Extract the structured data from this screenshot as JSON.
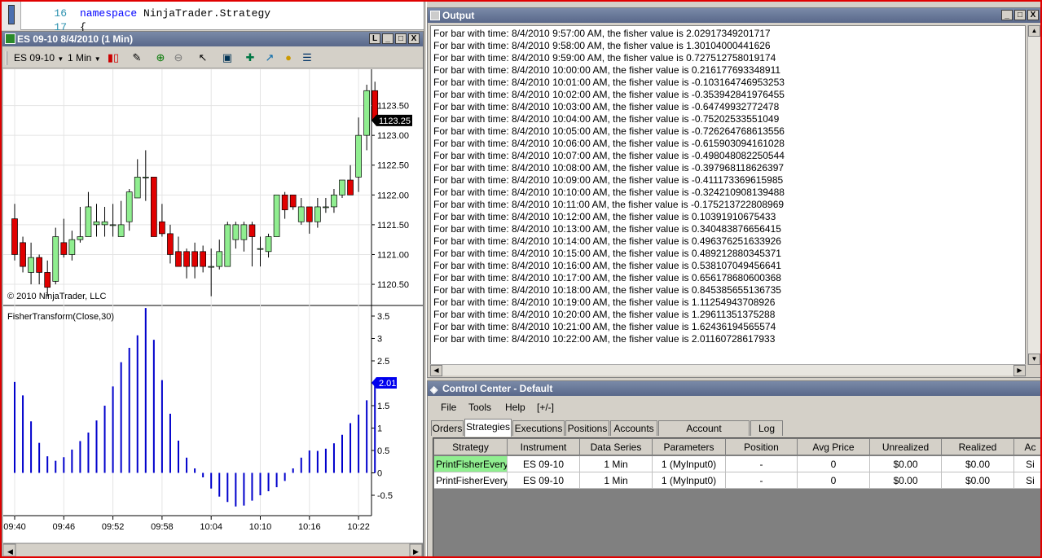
{
  "code": {
    "lines": [
      {
        "num": "16",
        "kw": "namespace",
        "text": " NinjaTrader.Strategy"
      },
      {
        "num": "17",
        "kw": "",
        "text": "{"
      }
    ]
  },
  "chart": {
    "title": "ES 09-10  8/4/2010 (1 Min)",
    "window_buttons": [
      "L",
      "_",
      "□",
      "X"
    ],
    "toolbar": {
      "instrument": "ES 09-10",
      "interval": "1 Min"
    },
    "copyright": "© 2010 NinjaTrader, LLC",
    "indicator_label": "FisherTransform(Close,30)",
    "price_label": "1123.25",
    "fisher_label": "2.01",
    "up_color": "#90ee90",
    "down_color": "#e00000",
    "fisher_color": "#0000cc"
  },
  "chart_data": [
    {
      "type": "candlestick",
      "name": "ES 09-10",
      "xlabels": [
        "09:40",
        "09:46",
        "09:52",
        "09:58",
        "10:04",
        "10:10",
        "10:16",
        "10:22"
      ],
      "yticks": [
        "1123.50",
        "1123.00",
        "1122.50",
        "1122.00",
        "1121.50",
        "1121.00",
        "1120.50"
      ],
      "ylim": [
        1120.2,
        1124.0
      ],
      "candles": [
        {
          "o": 1121.6,
          "h": 1121.85,
          "l": 1120.9,
          "c": 1121.0
        },
        {
          "o": 1121.2,
          "h": 1121.3,
          "l": 1120.7,
          "c": 1120.8
        },
        {
          "o": 1120.7,
          "h": 1121.2,
          "l": 1120.5,
          "c": 1120.95
        },
        {
          "o": 1120.95,
          "h": 1121.0,
          "l": 1120.5,
          "c": 1120.7
        },
        {
          "o": 1120.7,
          "h": 1120.9,
          "l": 1120.3,
          "c": 1120.45
        },
        {
          "o": 1120.55,
          "h": 1121.45,
          "l": 1120.5,
          "c": 1121.3
        },
        {
          "o": 1121.2,
          "h": 1121.6,
          "l": 1120.95,
          "c": 1121.0
        },
        {
          "o": 1121.0,
          "h": 1121.4,
          "l": 1120.9,
          "c": 1121.25
        },
        {
          "o": 1121.25,
          "h": 1121.8,
          "l": 1121.2,
          "c": 1121.3
        },
        {
          "o": 1121.3,
          "h": 1122.05,
          "l": 1121.3,
          "c": 1121.8
        },
        {
          "o": 1121.5,
          "h": 1121.85,
          "l": 1121.3,
          "c": 1121.55
        },
        {
          "o": 1121.5,
          "h": 1121.8,
          "l": 1121.3,
          "c": 1121.55
        },
        {
          "o": 1121.5,
          "h": 1121.85,
          "l": 1121.3,
          "c": 1121.5
        },
        {
          "o": 1121.3,
          "h": 1121.9,
          "l": 1121.3,
          "c": 1121.5
        },
        {
          "o": 1121.55,
          "h": 1122.1,
          "l": 1121.4,
          "c": 1122.05
        },
        {
          "o": 1121.95,
          "h": 1122.6,
          "l": 1121.95,
          "c": 1122.3
        },
        {
          "o": 1122.3,
          "h": 1122.75,
          "l": 1121.9,
          "c": 1122.3
        },
        {
          "o": 1122.3,
          "h": 1122.3,
          "l": 1121.3,
          "c": 1121.3
        },
        {
          "o": 1121.55,
          "h": 1121.85,
          "l": 1121.3,
          "c": 1121.35
        },
        {
          "o": 1121.35,
          "h": 1121.5,
          "l": 1120.85,
          "c": 1121.0
        },
        {
          "o": 1121.05,
          "h": 1121.3,
          "l": 1120.85,
          "c": 1120.8
        },
        {
          "o": 1121.05,
          "h": 1121.1,
          "l": 1120.6,
          "c": 1120.8
        },
        {
          "o": 1121.05,
          "h": 1121.2,
          "l": 1120.6,
          "c": 1120.8
        },
        {
          "o": 1121.05,
          "h": 1121.15,
          "l": 1120.7,
          "c": 1120.8
        },
        {
          "o": 1120.8,
          "h": 1121.1,
          "l": 1120.3,
          "c": 1120.8
        },
        {
          "o": 1120.8,
          "h": 1121.25,
          "l": 1120.75,
          "c": 1121.05
        },
        {
          "o": 1120.8,
          "h": 1121.55,
          "l": 1120.8,
          "c": 1121.5
        },
        {
          "o": 1121.25,
          "h": 1121.55,
          "l": 1121.1,
          "c": 1121.5
        },
        {
          "o": 1121.25,
          "h": 1121.55,
          "l": 1121.05,
          "c": 1121.5
        },
        {
          "o": 1121.5,
          "h": 1121.55,
          "l": 1120.8,
          "c": 1121.3
        },
        {
          "o": 1121.1,
          "h": 1121.3,
          "l": 1120.8,
          "c": 1121.1
        },
        {
          "o": 1121.05,
          "h": 1121.35,
          "l": 1120.95,
          "c": 1121.3
        },
        {
          "o": 1121.3,
          "h": 1122.0,
          "l": 1121.3,
          "c": 1122.0
        },
        {
          "o": 1122.0,
          "h": 1122.05,
          "l": 1121.6,
          "c": 1121.75
        },
        {
          "o": 1122.0,
          "h": 1122.0,
          "l": 1121.75,
          "c": 1121.8
        },
        {
          "o": 1121.55,
          "h": 1121.95,
          "l": 1121.5,
          "c": 1121.8
        },
        {
          "o": 1121.8,
          "h": 1121.8,
          "l": 1121.35,
          "c": 1121.55
        },
        {
          "o": 1121.55,
          "h": 1121.95,
          "l": 1121.45,
          "c": 1121.8
        },
        {
          "o": 1121.8,
          "h": 1121.95,
          "l": 1121.7,
          "c": 1121.8
        },
        {
          "o": 1121.8,
          "h": 1122.1,
          "l": 1121.7,
          "c": 1122.0
        },
        {
          "o": 1122.0,
          "h": 1122.25,
          "l": 1121.95,
          "c": 1122.25
        },
        {
          "o": 1122.25,
          "h": 1122.5,
          "l": 1122.05,
          "c": 1122.0
        },
        {
          "o": 1122.3,
          "h": 1123.3,
          "l": 1122.05,
          "c": 1123.0
        },
        {
          "o": 1123.0,
          "h": 1123.85,
          "l": 1122.75,
          "c": 1123.75
        },
        {
          "o": 1123.75,
          "h": 1123.9,
          "l": 1123.2,
          "c": 1123.25
        }
      ]
    },
    {
      "type": "bar",
      "name": "FisherTransform(Close,30)",
      "yticks": [
        "3.5",
        "3",
        "2.5",
        "2",
        "1.5",
        "1",
        "0.5",
        "0",
        "-0.5"
      ],
      "ylim": [
        -0.9,
        3.7
      ],
      "values": [
        2.03,
        1.73,
        1.15,
        0.67,
        0.37,
        0.27,
        0.35,
        0.52,
        0.71,
        0.9,
        1.17,
        1.5,
        1.93,
        2.47,
        2.79,
        3.07,
        3.68,
        2.97,
        2.07,
        1.32,
        0.72,
        0.34,
        0.1,
        -0.1,
        -0.35,
        -0.53,
        -0.65,
        -0.75,
        -0.73,
        -0.62,
        -0.5,
        -0.41,
        -0.32,
        -0.18,
        0.1,
        0.34,
        0.5,
        0.49,
        0.54,
        0.66,
        0.85,
        1.11,
        1.3,
        1.62,
        2.01
      ]
    }
  ],
  "output": {
    "title": "Output",
    "lines": [
      "For bar with time: 8/4/2010 9:57:00 AM, the fisher value is 2.02917349201717",
      "For bar with time: 8/4/2010 9:58:00 AM, the fisher value is 1.30104000441626",
      "For bar with time: 8/4/2010 9:59:00 AM, the fisher value is 0.727512758019174",
      "For bar with time: 8/4/2010 10:00:00 AM, the fisher value is 0.216177693348911",
      "For bar with time: 8/4/2010 10:01:00 AM, the fisher value is -0.103164746953253",
      "For bar with time: 8/4/2010 10:02:00 AM, the fisher value is -0.353942841976455",
      "For bar with time: 8/4/2010 10:03:00 AM, the fisher value is -0.64749932772478",
      "For bar with time: 8/4/2010 10:04:00 AM, the fisher value is -0.75202533551049",
      "For bar with time: 8/4/2010 10:05:00 AM, the fisher value is -0.726264768613556",
      "For bar with time: 8/4/2010 10:06:00 AM, the fisher value is -0.615903094161028",
      "For bar with time: 8/4/2010 10:07:00 AM, the fisher value is -0.498048082250544",
      "For bar with time: 8/4/2010 10:08:00 AM, the fisher value is -0.397968118626397",
      "For bar with time: 8/4/2010 10:09:00 AM, the fisher value is -0.411173369615985",
      "For bar with time: 8/4/2010 10:10:00 AM, the fisher value is -0.324210908139488",
      "For bar with time: 8/4/2010 10:11:00 AM, the fisher value is -0.175213722808969",
      "For bar with time: 8/4/2010 10:12:00 AM, the fisher value is 0.10391910675433",
      "For bar with time: 8/4/2010 10:13:00 AM, the fisher value is 0.340483876656415",
      "For bar with time: 8/4/2010 10:14:00 AM, the fisher value is 0.496376251633926",
      "For bar with time: 8/4/2010 10:15:00 AM, the fisher value is 0.489212880345371",
      "For bar with time: 8/4/2010 10:16:00 AM, the fisher value is 0.538107049456641",
      "For bar with time: 8/4/2010 10:17:00 AM, the fisher value is 0.656178680600368",
      "For bar with time: 8/4/2010 10:18:00 AM, the fisher value is 0.845385655136735",
      "For bar with time: 8/4/2010 10:19:00 AM, the fisher value is 1.11254943708926",
      "For bar with time: 8/4/2010 10:20:00 AM, the fisher value is 1.29611351375288",
      "For bar with time: 8/4/2010 10:21:00 AM, the fisher value is 1.62436194565574",
      "For bar with time: 8/4/2010 10:22:00 AM, the fisher value is 2.01160728617933"
    ]
  },
  "control": {
    "title": "Control Center - Default",
    "menu": [
      "File",
      "Tools",
      "Help",
      "[+/-]"
    ],
    "tabs": [
      "Orders",
      "Strategies",
      "Executions",
      "Positions",
      "Accounts",
      "Account Performance",
      "Log"
    ],
    "active_tab": "Strategies",
    "columns": [
      "Strategy",
      "Instrument",
      "Data Series",
      "Parameters",
      "Position",
      "Avg Price",
      "Unrealized",
      "Realized",
      "Ac"
    ],
    "rows": [
      [
        "PrintFisherEvery",
        "ES 09-10",
        "1 Min",
        "1 (MyInput0)",
        "-",
        "0",
        "$0.00",
        "$0.00",
        "Si"
      ],
      [
        "PrintFisherEvery",
        "ES 09-10",
        "1 Min",
        "1 (MyInput0)",
        "-",
        "0",
        "$0.00",
        "$0.00",
        "Si"
      ]
    ],
    "enabled_color": "#90ee90"
  }
}
